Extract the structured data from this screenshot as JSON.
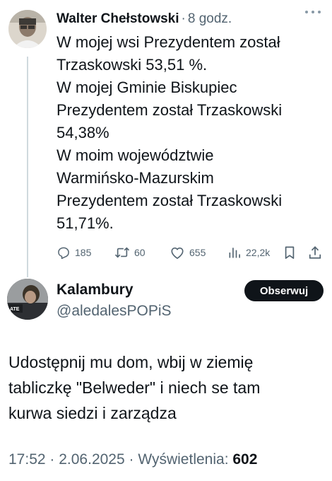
{
  "parent": {
    "author_name": "Walter Chełstowski",
    "time": "8 godz.",
    "separator": "·",
    "text_lines": [
      "W mojej wsi Prezydentem został",
      "Trzaskowski 53,51 %.",
      "W mojej Gminie Biskupiec",
      "Prezydentem został Trzaskowski",
      "54,38%",
      "W moim województwie",
      "Warmińsko-Mazurskim",
      "Prezydentem został Trzaskowski",
      "51,71%."
    ],
    "actions": {
      "replies": "185",
      "reposts": "60",
      "likes": "655",
      "views": "22,2k"
    },
    "icons": [
      "more-icon",
      "reply-icon",
      "repost-icon",
      "like-icon",
      "views-icon",
      "bookmark-icon",
      "share-icon"
    ]
  },
  "reply": {
    "author_name": "Kalambury",
    "handle": "@aledalesPOPiS",
    "follow_label": "Obserwuj",
    "text_lines": [
      "Udostępnij mu dom, wbij w ziemię",
      "tabliczkę \"Belweder\" i niech se tam",
      "kurwa siedzi i zarządza"
    ],
    "time": "17:52",
    "date": "2.06.2025",
    "views_label": "Wyświetlenia:",
    "views_count": "602"
  },
  "colors": {
    "text": "#0f1419",
    "secondary": "#536471",
    "button_bg": "#0f1419",
    "thread_line": "#cfd9de"
  }
}
